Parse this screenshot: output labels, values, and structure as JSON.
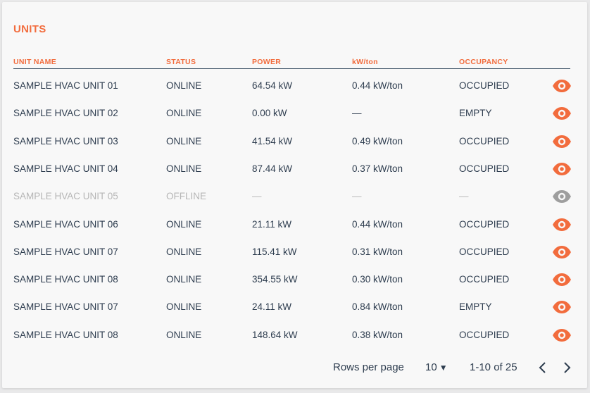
{
  "title": "UNITS",
  "columns": {
    "unit_name": "UNIT NAME",
    "status": "STATUS",
    "power": "POWER",
    "kw_ton": "kW/ton",
    "occupancy": "OCCUPANCY"
  },
  "rows": [
    {
      "name": "SAMPLE HVAC UNIT 01",
      "status": "ONLINE",
      "power": "64.54 kW",
      "kw_ton": "0.44 kW/ton",
      "occupancy": "OCCUPIED",
      "offline": false
    },
    {
      "name": "SAMPLE HVAC UNIT 02",
      "status": "ONLINE",
      "power": "0.00 kW",
      "kw_ton": "—",
      "occupancy": "EMPTY",
      "offline": false
    },
    {
      "name": "SAMPLE HVAC UNIT 03",
      "status": "ONLINE",
      "power": "41.54 kW",
      "kw_ton": "0.49 kW/ton",
      "occupancy": "OCCUPIED",
      "offline": false
    },
    {
      "name": "SAMPLE HVAC UNIT 04",
      "status": "ONLINE",
      "power": "87.44 kW",
      "kw_ton": "0.37 kW/ton",
      "occupancy": "OCCUPIED",
      "offline": false
    },
    {
      "name": "SAMPLE HVAC UNIT 05",
      "status": "OFFLINE",
      "power": "—",
      "kw_ton": "—",
      "occupancy": "—",
      "offline": true
    },
    {
      "name": "SAMPLE HVAC UNIT 06",
      "status": "ONLINE",
      "power": "21.11 kW",
      "kw_ton": "0.44 kW/ton",
      "occupancy": "OCCUPIED",
      "offline": false
    },
    {
      "name": "SAMPLE HVAC UNIT 07",
      "status": "ONLINE",
      "power": "115.41 kW",
      "kw_ton": "0.31 kW/ton",
      "occupancy": "OCCUPIED",
      "offline": false
    },
    {
      "name": "SAMPLE HVAC UNIT 08",
      "status": "ONLINE",
      "power": "354.55 kW",
      "kw_ton": "0.30 kW/ton",
      "occupancy": "OCCUPIED",
      "offline": false
    },
    {
      "name": "SAMPLE HVAC UNIT 07",
      "status": "ONLINE",
      "power": "24.11 kW",
      "kw_ton": "0.84 kW/ton",
      "occupancy": "EMPTY",
      "offline": false
    },
    {
      "name": "SAMPLE HVAC UNIT 08",
      "status": "ONLINE",
      "power": "148.64 kW",
      "kw_ton": "0.38 kW/ton",
      "occupancy": "OCCUPIED",
      "offline": false
    }
  ],
  "row_action_icon": "eye-icon",
  "pagination": {
    "rows_per_page_label": "Rows per page",
    "rows_per_page_value": "10",
    "range_label": "1-10 of 25",
    "prev_icon": "chevron-left-icon",
    "next_icon": "chevron-right-icon"
  },
  "colors": {
    "accent": "#f26c3d",
    "text": "#2e3d4f",
    "offline_text": "#b6b6b6",
    "offline_icon": "#9e9e9e",
    "card_background": "#f8f8f8"
  }
}
